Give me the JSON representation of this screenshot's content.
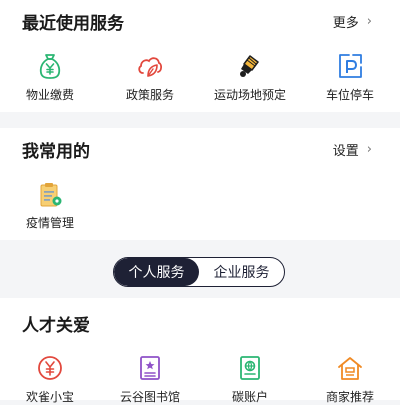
{
  "recent": {
    "title": "最近使用服务",
    "link": "更多",
    "items": [
      {
        "label": "物业缴费",
        "icon": "money-bag-icon"
      },
      {
        "label": "政策服务",
        "icon": "leaf-cloud-icon"
      },
      {
        "label": "运动场地预定",
        "icon": "badminton-icon"
      },
      {
        "label": "车位停车",
        "icon": "parking-icon"
      }
    ]
  },
  "mine": {
    "title": "我常用的",
    "link": "设置",
    "items": [
      {
        "label": "疫情管理",
        "icon": "clipboard-icon"
      }
    ]
  },
  "toggle": {
    "options": [
      "个人服务",
      "企业服务"
    ],
    "active": 0
  },
  "talent": {
    "title": "人才关爱",
    "items": [
      {
        "label": "欢雀小宝",
        "icon": "yuan-icon"
      },
      {
        "label": "云谷图书馆",
        "icon": "book-icon"
      },
      {
        "label": "碳账户",
        "icon": "passbook-icon"
      },
      {
        "label": "商家推荐",
        "icon": "shop-icon"
      }
    ]
  },
  "colors": {
    "green": "#2bb673",
    "red": "#e2483d",
    "blue": "#2f7de1",
    "orange": "#f08a24",
    "purple": "#8f52c8",
    "dark": "#1e2135"
  }
}
